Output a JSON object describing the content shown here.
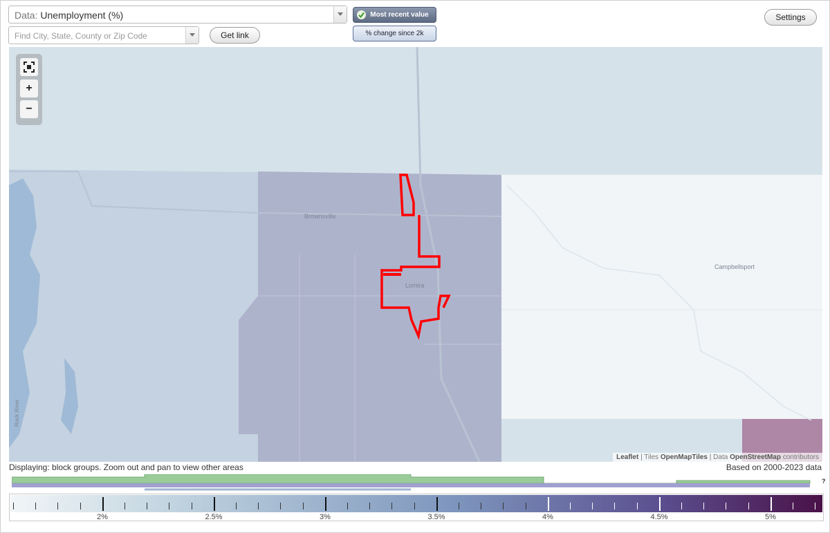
{
  "controls": {
    "data_select": {
      "prefix": "Data:",
      "value": "Unemployment (%)"
    },
    "search": {
      "placeholder": "Find City, State, County or Zip Code"
    },
    "get_link_label": "Get link",
    "toggle_recent_label": "Most recent value",
    "toggle_change_label": "% change since 2k",
    "settings_label": "Settings"
  },
  "map": {
    "places": {
      "brownsville": "Brownsville",
      "lomira": "Lomira",
      "campbellsport": "Campbellsport",
      "rock_river": "Rock River"
    },
    "zoom": {
      "fullscreen_icon": "fullscreen-icon",
      "zoom_in": "+",
      "zoom_out": "−"
    },
    "attribution": {
      "leaflet": "Leaflet",
      "sep1": " | Tiles ",
      "tiles": "OpenMapTiles",
      "sep2": " | Data ",
      "data": "OpenStreetMap",
      "tail": " contributors"
    }
  },
  "status": {
    "displaying": "Displaying: block groups. Zoom out and pan to view other areas",
    "based_on": "Based on 2000-2023 data",
    "help": "?"
  },
  "legend": {
    "ticks": [
      "2%",
      "2.5%",
      "3%",
      "3.5%",
      "4%",
      "4.5%",
      "5%"
    ],
    "gradient": {
      "start": "#f2f6f8",
      "mid": "#7d95bd",
      "end": "#4a1148"
    }
  },
  "colors": {
    "highlight": "#ff0000",
    "area_light": "#d6e2ea",
    "area_mid": "#aeb3cc",
    "area_white": "#f1f5f7",
    "area_purple": "#ae86a6",
    "histogram_green": "#99cc99",
    "histogram_purple": "#a0a0d0"
  }
}
